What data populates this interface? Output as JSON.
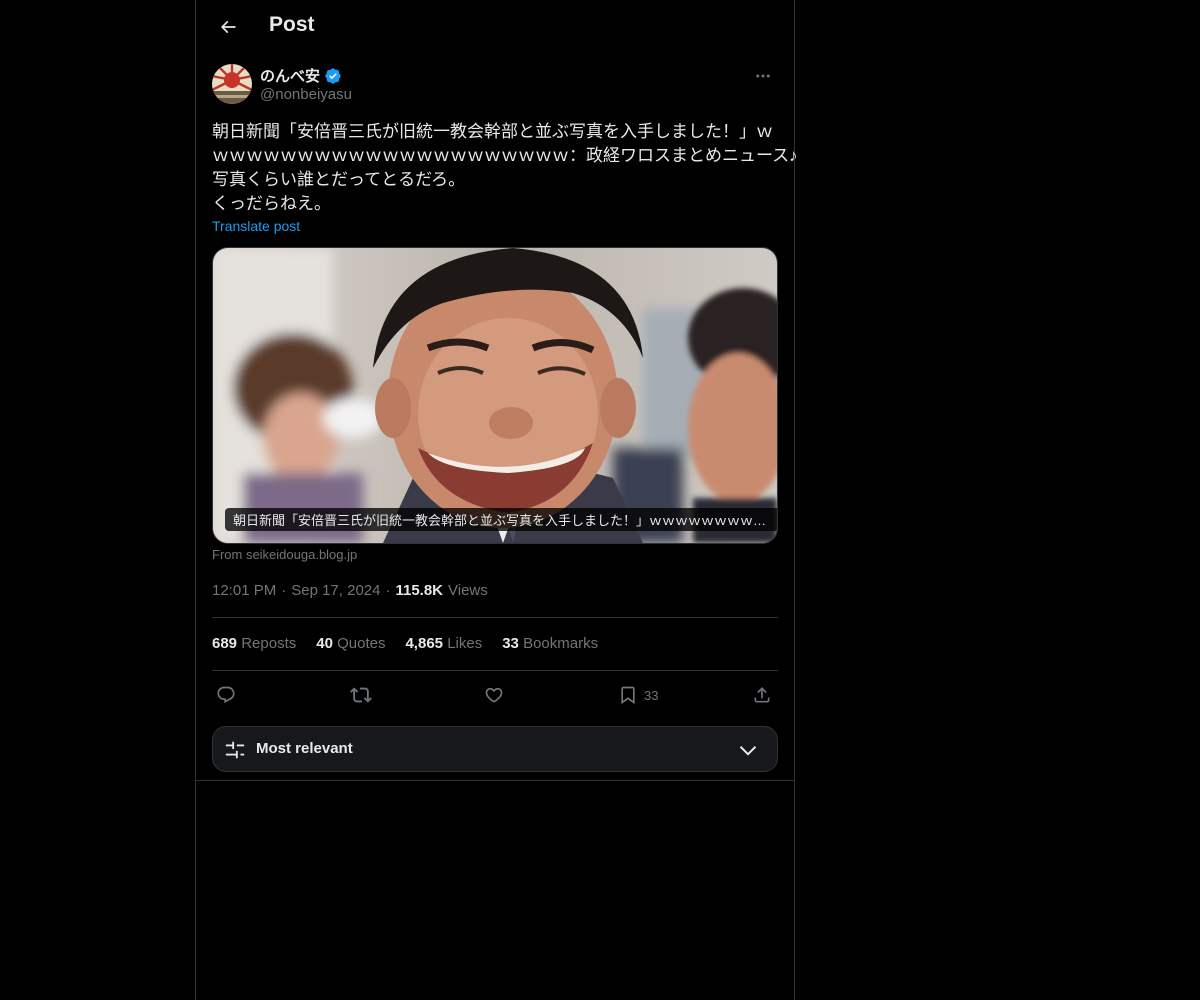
{
  "header": {
    "title": "Post",
    "back_icon": "arrow-left-icon"
  },
  "author": {
    "display_name": "のんべ安",
    "handle": "@nonbeiyasu",
    "verified": true,
    "verified_color": "#1d9bf0"
  },
  "post": {
    "lines": [
      "朝日新聞「安倍晋三氏が旧統一教会幹部と並ぶ写真を入手しました！」ｗ",
      "ｗｗｗｗｗｗｗｗｗｗｗｗｗｗｗｗｗｗｗｗｗ：政経ワロスまとめニュース♪",
      "写真くらい誰とだってとるだろ。",
      "くっだらねえ。"
    ],
    "translate_label": "Translate post",
    "card_caption": "朝日新聞「安倍晋三氏が旧統一教会幹部と並ぶ写真を入手しました！」ｗｗｗｗｗｗｗｗｗｗｗｗｗｗｗｗｗｗ",
    "card_source": "From seikeidouga.blog.jp"
  },
  "meta": {
    "time": "12:01 PM",
    "date": "Sep 17, 2024",
    "views_count": "115.8K",
    "views_label": "Views"
  },
  "stats": [
    {
      "num": "689",
      "label": "Reposts"
    },
    {
      "num": "40",
      "label": "Quotes"
    },
    {
      "num": "4,865",
      "label": "Likes"
    },
    {
      "num": "33",
      "label": "Bookmarks"
    }
  ],
  "actions": {
    "reply_icon": "reply-icon",
    "repost_icon": "repost-icon",
    "like_icon": "heart-icon",
    "bookmark_icon": "bookmark-icon",
    "bookmark_count": "33",
    "share_icon": "share-icon"
  },
  "sort": {
    "label": "Most relevant"
  },
  "colors": {
    "accent": "#1d9bf0",
    "muted": "#71767b",
    "text": "#e7e9ea",
    "border": "#2f3336",
    "background": "#000000"
  }
}
